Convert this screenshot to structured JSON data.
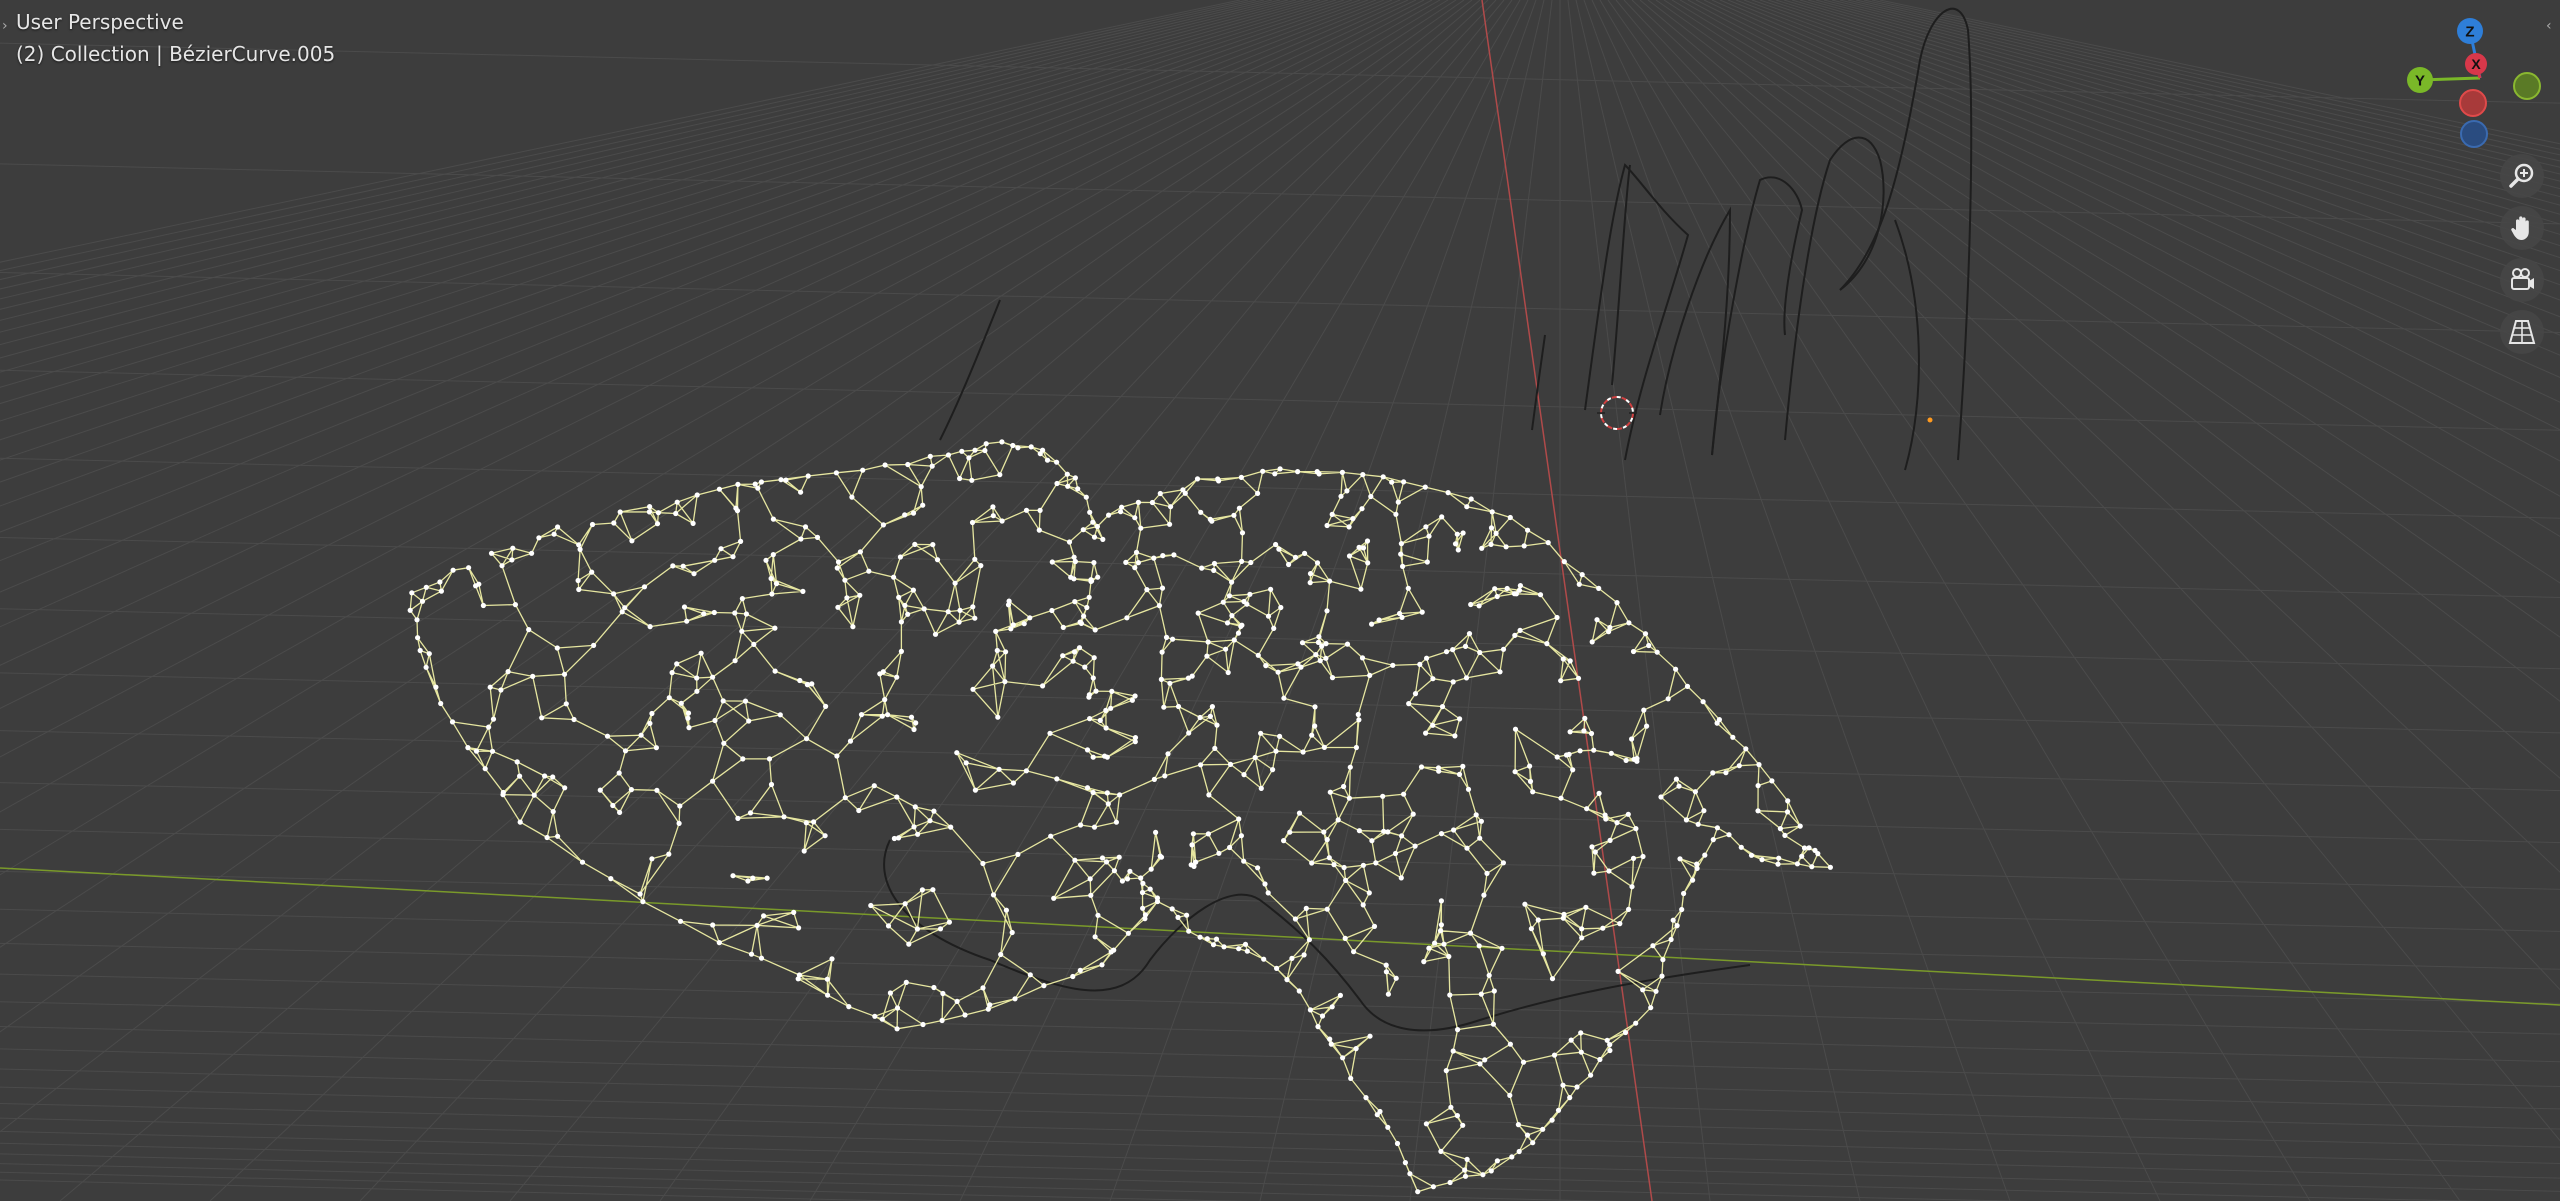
{
  "viewport": {
    "view_name": "User Perspective",
    "context_label": "(2) Collection | BézierCurve.005",
    "colors": {
      "background": "#3d3d3d",
      "grid": "#4b4b4b",
      "x_axis": "#b04a4a",
      "y_axis": "#7a9a2a",
      "selected_wire": "#e6e6a0",
      "vertex": "#ffffff",
      "curve": "#1e1e1e",
      "cursor": "#d04040"
    }
  },
  "gizmo": {
    "z_label": "Z",
    "y_label": "Y",
    "x_label": "X",
    "colors": {
      "z": "#2e7ed8",
      "y": "#7ab828",
      "x": "#d8384a",
      "neg_x": "#c84040",
      "neg_y": "#5a7a26",
      "neg_z": "#2a4c80"
    }
  },
  "navigation": {
    "zoom_icon": "zoom-icon",
    "pan_icon": "hand-icon",
    "camera_icon": "camera-icon",
    "perspective_icon": "perspective-grid-icon"
  }
}
